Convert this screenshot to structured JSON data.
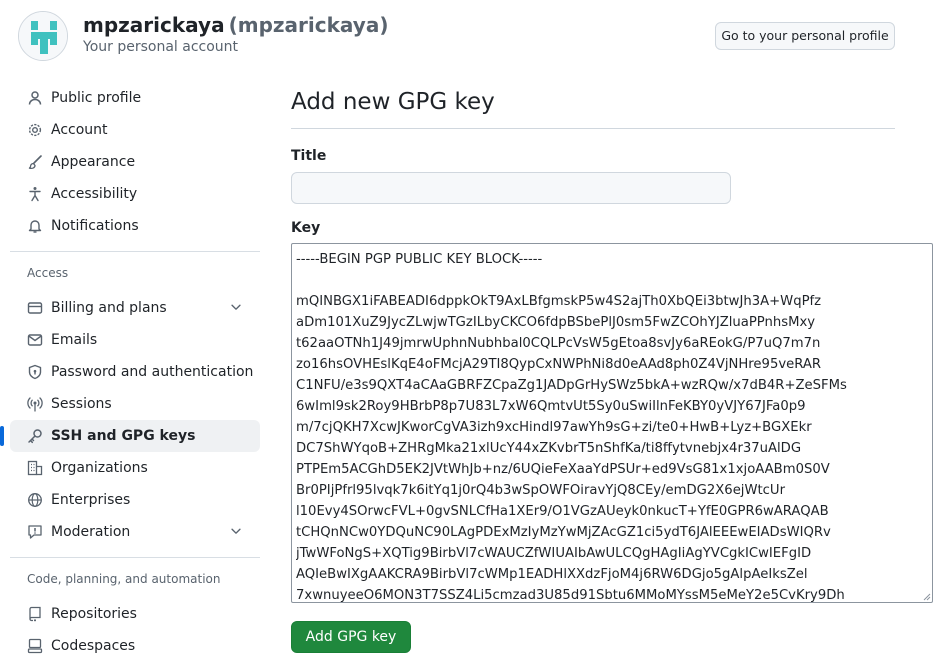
{
  "header": {
    "display_name": "mpzarickaya",
    "login": "(mpzarickaya)",
    "subtitle": "Your personal account",
    "profile_button": "Go to your personal profile"
  },
  "sidebar": {
    "items": [
      {
        "label": "Public profile",
        "icon": "person-icon"
      },
      {
        "label": "Account",
        "icon": "gear-icon"
      },
      {
        "label": "Appearance",
        "icon": "paintbrush-icon"
      },
      {
        "label": "Accessibility",
        "icon": "accessibility-icon"
      },
      {
        "label": "Notifications",
        "icon": "bell-icon"
      }
    ],
    "access": {
      "title": "Access",
      "items": [
        {
          "label": "Billing and plans",
          "icon": "credit-card-icon",
          "expandable": true
        },
        {
          "label": "Emails",
          "icon": "mail-icon"
        },
        {
          "label": "Password and authentication",
          "icon": "shield-lock-icon"
        },
        {
          "label": "Sessions",
          "icon": "broadcast-icon"
        },
        {
          "label": "SSH and GPG keys",
          "icon": "key-icon",
          "active": true
        },
        {
          "label": "Organizations",
          "icon": "organization-icon"
        },
        {
          "label": "Enterprises",
          "icon": "globe-icon"
        },
        {
          "label": "Moderation",
          "icon": "report-icon",
          "expandable": true
        }
      ]
    },
    "code": {
      "title": "Code, planning, and automation",
      "items": [
        {
          "label": "Repositories",
          "icon": "repo-icon"
        },
        {
          "label": "Codespaces",
          "icon": "codespaces-icon"
        }
      ]
    }
  },
  "main": {
    "title": "Add new GPG key",
    "title_label": "Title",
    "title_value": "",
    "key_label": "Key",
    "key_lines": [
      "-----BEGIN PGP PUBLIC KEY BLOCK-----",
      "",
      "mQINBGX1iFABEADI6dppkOkT9AxLBfgmskP5w4S2ajTh0XbQEi3btwJh3A+WqPfz",
      "aDm101XuZ9JycZLwjwTGzILbyCKCO6fdpBSbePlJ0sm5FwZCOhYJZluaPPnhsMxy",
      "t62aaOTNh1J49jmrwUphnNubhbal0CQLPcVsW5gEtoa8svJy6aREokG/P7uQ7m7n",
      "zo16hsOVHEslKqE4oFMcjA29TI8QypCxNWPhNi8d0eAAd8ph0Z4VjNHre95veRAR",
      "C1NFU/e3s9QXT4aCAaGBRFZCpaZg1JADpGrHySWz5bkA+wzRQw/x7dB4R+ZeSFMs",
      "6wIml9sk2Roy9HBrbP8p7U83L7xW6QmtvUt5Sy0uSwiIlnFeKBY0yVJY67JFa0p9",
      "m/7cjQKH7XcwJKworCgVA3izh9xcHindl97awYh9sG+zi/te0+HwB+Lyz+BGXEkr",
      "DC7ShWYqoB+ZHRgMka21xlUcY44xZKvbrT5nShfKa/ti8ffytvnebjx4r37uAlDG",
      "PTPEm5ACGhD5EK2JVtWhJb+nz/6UQieFeXaaYdPSUr+ed9VsG81x1xjoAABm0S0V",
      "Br0PIjPfrl95lvqk7k6itYq1j0rQ4b3wSpOWFOiravYjQ8CEy/emDG2X6ejWtcUr",
      "l10Evy4SOrwcFVL+0gvSNLCfHa1XEr9/O1VGzAUeyk0nkucT+YfE0GPR6wARAQAB",
      "tCHQnNCw0YDQuNC90LAgPDExMzIyMzYwMjZAcGZ1ci5ydT6JAlEEEwEIADsWIQRv",
      "jTwWFoNgS+XQTig9BirbVl7cWAUCZfWIUAIbAwULCQgHAgIiAgYVCgkICwIEFgID",
      "AQIeBwIXgAAKCRA9BirbVl7cWMp1EADHlXXdzFjoM4j6RW6DGjo5gAlpAeIksZel",
      "7xwnuyeeO6MON3T7SSZ4Li5cmzad3U85d91Sbtu6MMoMYssM5eMeY2e5CvKry9Dh"
    ],
    "submit_label": "Add GPG key"
  },
  "colors": {
    "accent": "#0969da",
    "primary_button": "#1f883d",
    "muted_text": "#59636e",
    "border": "#d0d7de"
  }
}
